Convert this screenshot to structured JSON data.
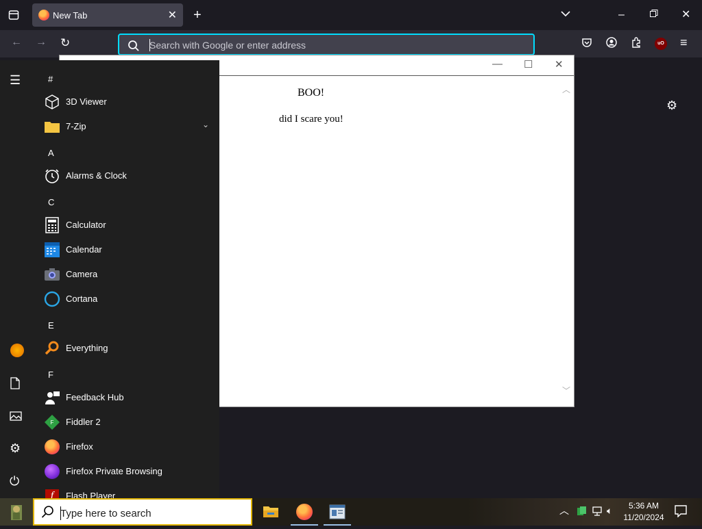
{
  "browser": {
    "tab_title": "New Tab",
    "url_placeholder": "Search with Google or enter address"
  },
  "window": {
    "doc_heading": "BOO!",
    "doc_text": "did I scare you!"
  },
  "start_menu": {
    "sections": [
      {
        "header": "#",
        "apps": [
          {
            "label": "3D Viewer",
            "icon": "cube-icon"
          },
          {
            "label": "7-Zip",
            "icon": "folder-icon",
            "expandable": true
          }
        ]
      },
      {
        "header": "A",
        "apps": [
          {
            "label": "Alarms & Clock",
            "icon": "alarm-clock-icon"
          }
        ]
      },
      {
        "header": "C",
        "apps": [
          {
            "label": "Calculator",
            "icon": "calculator-icon"
          },
          {
            "label": "Calendar",
            "icon": "calendar-icon"
          },
          {
            "label": "Camera",
            "icon": "camera-icon"
          },
          {
            "label": "Cortana",
            "icon": "cortana-icon"
          }
        ]
      },
      {
        "header": "E",
        "apps": [
          {
            "label": "Everything",
            "icon": "magnifier-icon"
          }
        ]
      },
      {
        "header": "F",
        "apps": [
          {
            "label": "Feedback Hub",
            "icon": "feedback-hub-icon"
          },
          {
            "label": "Fiddler 2",
            "icon": "fiddler-icon"
          },
          {
            "label": "Firefox",
            "icon": "firefox-icon"
          },
          {
            "label": "Firefox Private Browsing",
            "icon": "private-browsing-icon"
          },
          {
            "label": "Flash Player",
            "icon": "flash-icon"
          }
        ]
      }
    ]
  },
  "taskbar": {
    "search_placeholder": "Type here to search",
    "time": "5:36 AM",
    "date": "11/20/2024"
  },
  "colors": {
    "accent": "#00ddff",
    "chrome_dark": "#1c1b22",
    "start_bg": "#1f1f1f",
    "search_border": "#e0b400"
  }
}
